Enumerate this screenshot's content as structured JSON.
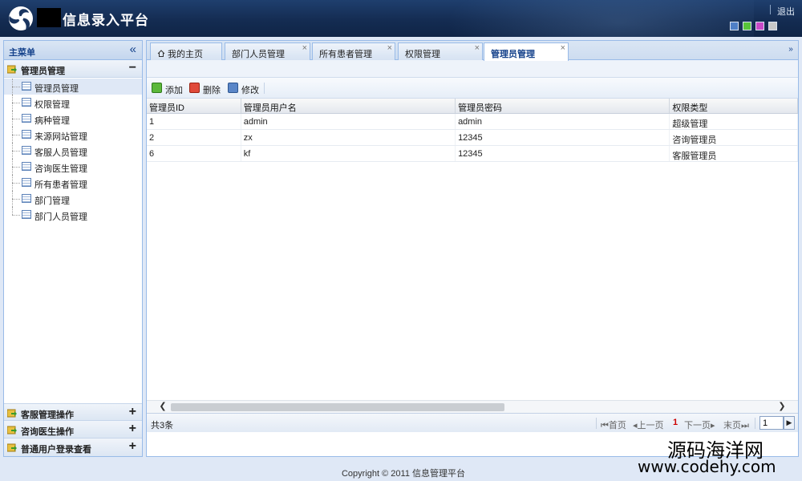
{
  "header": {
    "title": "信息录入平台",
    "logout": "退出",
    "themes": [
      "#4f7fc6",
      "#58c43a",
      "#c84ac8",
      "#c8c8c8"
    ]
  },
  "sidebar": {
    "title": "主菜单",
    "sections": [
      {
        "label": "管理员管理",
        "expanded_sign": "−",
        "items": [
          {
            "label": "管理员管理"
          },
          {
            "label": "权限管理"
          },
          {
            "label": "病种管理"
          },
          {
            "label": "来源网站管理"
          },
          {
            "label": "客服人员管理"
          },
          {
            "label": "咨询医生管理"
          },
          {
            "label": "所有患者管理"
          },
          {
            "label": "部门管理"
          },
          {
            "label": "部门人员管理"
          }
        ]
      },
      {
        "label": "客服管理操作",
        "sign": "+"
      },
      {
        "label": "咨询医生操作",
        "sign": "+"
      },
      {
        "label": "普通用户登录查看",
        "sign": "+"
      }
    ]
  },
  "tabs": [
    {
      "label": "我的主页"
    },
    {
      "label": "部门人员管理"
    },
    {
      "label": "所有患者管理"
    },
    {
      "label": "权限管理"
    },
    {
      "label": "管理员管理"
    }
  ],
  "toolbar": {
    "add": "添加",
    "delete": "删除",
    "edit": "修改"
  },
  "grid": {
    "columns": [
      "管理员ID",
      "管理员用户名",
      "管理员密码",
      "权限类型"
    ],
    "rows": [
      [
        "1",
        "admin",
        "admin",
        "超级管理"
      ],
      [
        "2",
        "zx",
        "12345",
        "咨询管理员"
      ],
      [
        "6",
        "kf",
        "12345",
        "客服管理员"
      ]
    ]
  },
  "pager": {
    "total": "共3条",
    "first": "首页",
    "prev": "上一页",
    "current": "1",
    "next": "下一页",
    "last": "末页",
    "page_input": "1"
  },
  "footer": {
    "copyright": "Copyright © 2011 信息管理平台"
  },
  "watermark": {
    "line1": "源码海洋网",
    "line2": "www.codehy.com"
  }
}
